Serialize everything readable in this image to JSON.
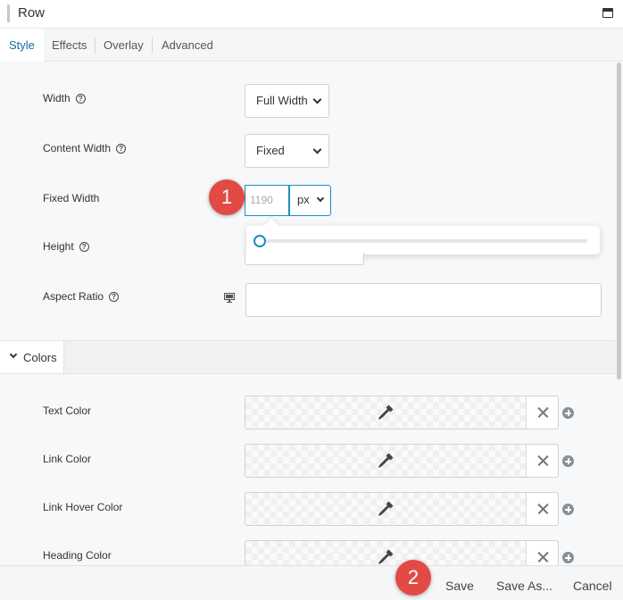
{
  "panel": {
    "title": "Row"
  },
  "tabs": [
    {
      "label": "Style",
      "active": true
    },
    {
      "label": "Effects",
      "active": false
    },
    {
      "label": "Overlay",
      "active": false
    },
    {
      "label": "Advanced",
      "active": false
    }
  ],
  "fields": {
    "width": {
      "label": "Width",
      "value": "Full Width"
    },
    "content_width": {
      "label": "Content Width",
      "value": "Fixed"
    },
    "fixed_width": {
      "label": "Fixed Width",
      "placeholder": "1190",
      "unit": "px"
    },
    "height": {
      "label": "Height"
    },
    "aspect_ratio": {
      "label": "Aspect Ratio",
      "value": ""
    }
  },
  "colors_section": {
    "label": "Colors",
    "items": [
      {
        "label": "Text Color"
      },
      {
        "label": "Link Color"
      },
      {
        "label": "Link Hover Color"
      },
      {
        "label": "Heading Color"
      }
    ]
  },
  "footer": {
    "save": "Save",
    "save_as": "Save As...",
    "cancel": "Cancel"
  },
  "callouts": [
    "1",
    "2"
  ],
  "accent_color": "#1b8ec1",
  "badge_color": "#e24a46"
}
